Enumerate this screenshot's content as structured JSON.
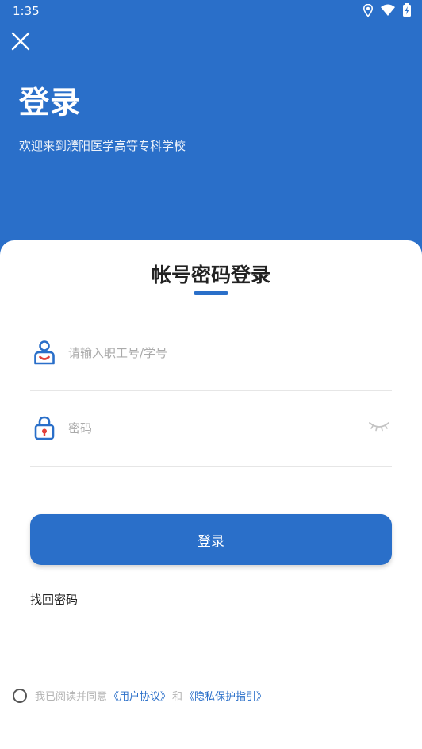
{
  "status_bar": {
    "time": "1:35",
    "icons": [
      "location-icon",
      "wifi-icon",
      "battery-charging-icon"
    ]
  },
  "header": {
    "close_icon": "close-icon",
    "title": "登录",
    "subtitle": "欢迎来到濮阳医学高等专科学校"
  },
  "login_card": {
    "title": "帐号密码登录",
    "username": {
      "icon": "user-icon",
      "placeholder": "请输入职工号/学号",
      "value": ""
    },
    "password": {
      "icon": "lock-icon",
      "placeholder": "密码",
      "value": "",
      "toggle_icon": "eye-closed-icon"
    },
    "login_button": "登录",
    "forgot_password": "找回密码"
  },
  "agreement": {
    "prefix": "我已阅读并同意",
    "user_agreement": "《用户协议》",
    "conjunction": "和",
    "privacy_policy": "《隐私保护指引》"
  },
  "colors": {
    "primary": "#2a6fc9",
    "icon_red": "#e2403a",
    "placeholder": "#aaaaaa",
    "muted_text": "#b3b3b3"
  }
}
